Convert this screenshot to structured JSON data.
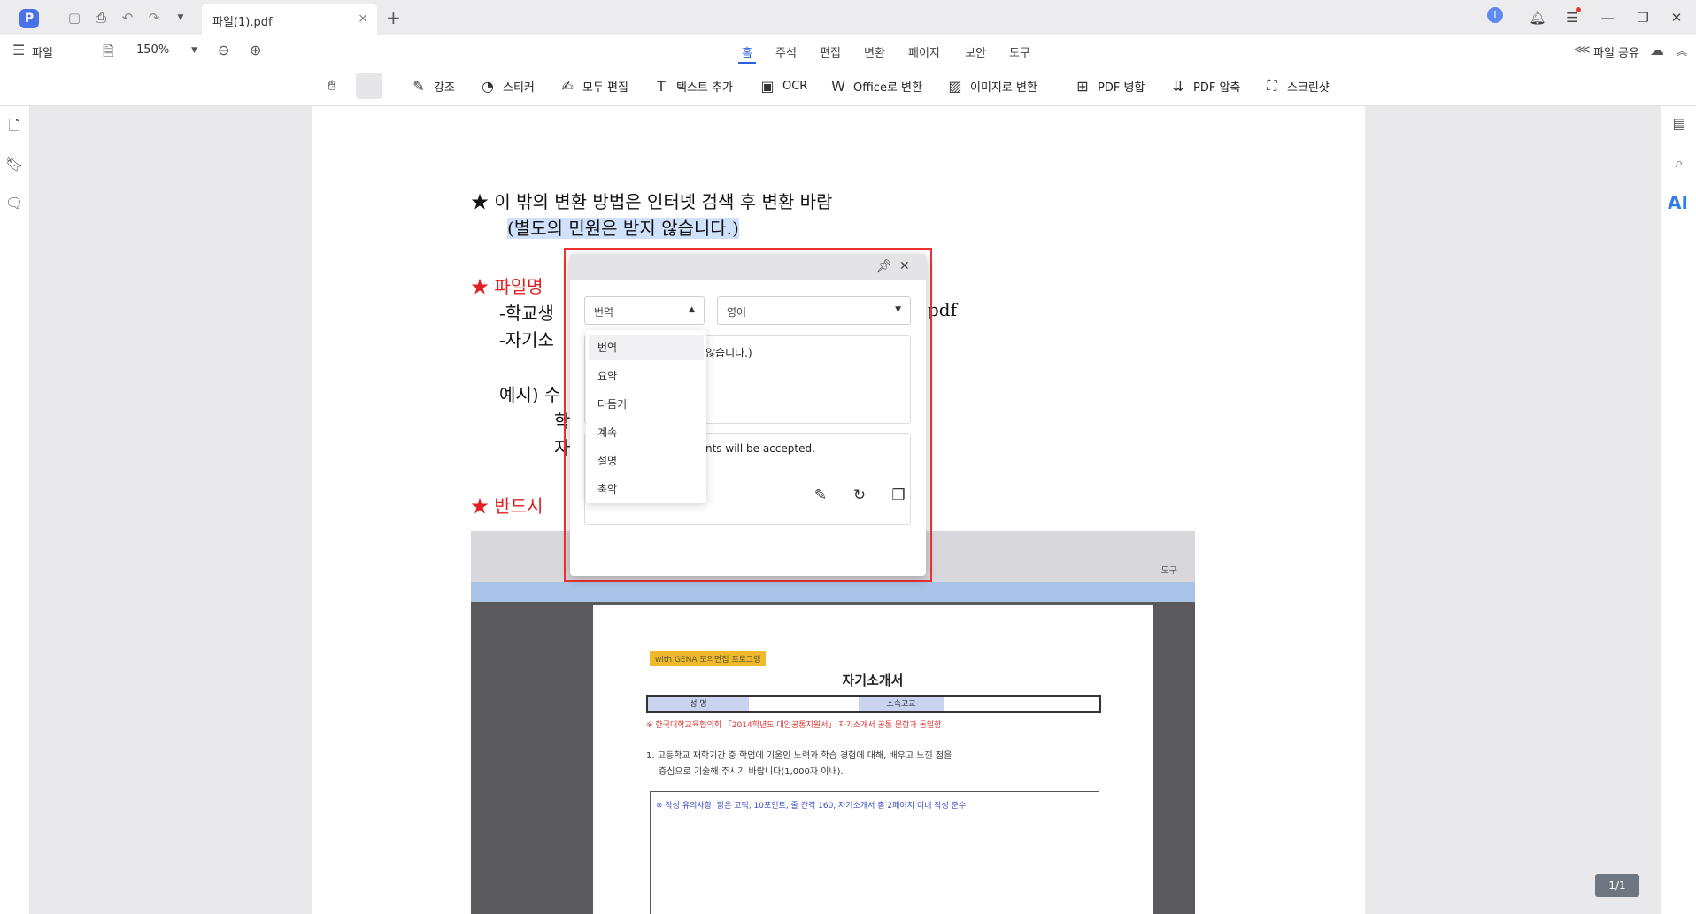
{
  "titlebar": {
    "tab_title": "파일(1).pdf",
    "tab_close": "×",
    "tab_add": "+",
    "user_initial": "I"
  },
  "menubar": {
    "file_label": "파일",
    "zoom_value": "150%",
    "nav_tabs": [
      "홈",
      "주석",
      "편집",
      "변환",
      "페이지",
      "보안",
      "도구"
    ],
    "active_tab": "홈",
    "share_label": "파일 공유"
  },
  "toolbar": {
    "tools": [
      "강조",
      "스티커",
      "모두 편집",
      "텍스트 추가",
      "OCR",
      "Office로 변환",
      "이미지로 변환",
      "PDF 병합",
      "PDF 압축",
      "스크린샷"
    ]
  },
  "right_rail": {
    "ai_label": "AI"
  },
  "document": {
    "line1": "★ 이 밖의 변환 방법은 인터넷 검색 후 변환 바람",
    "line2": "(별도의 민원은 받지 않습니다.)",
    "heading_filename": "★ 파일명",
    "line_student": "-학교생",
    "line_pdf_suffix": "pdf",
    "line_self": "-자기소",
    "example_label": "예시) 수",
    "example_ha": "학",
    "example_ja": "자",
    "heading_must": "★ 반드시"
  },
  "embedded_image": {
    "tag": "with GENA 모의면접 프로그램",
    "title": "자기소개서",
    "table_cells": [
      "성  명",
      "소속고교"
    ],
    "note": "※ 한국대학교육협의회 「2014학년도 대입공통지원서」 자기소개서 공통 문항과 동일함",
    "question": "1. 고등학교 재학기간 중 학업에 기울인 노력과 학습 경험에 대해, 배우고 느낀 점을",
    "question_line2": "중심으로 기술해 주시기 바랍니다(1,000자 이내).",
    "box_text": "※ 작성 유의사항: 맑은 고딕, 10포인트, 줄 간격 160, 자기소개서 총 2페이지 이내 작성 준수",
    "toolbar_text": "도구"
  },
  "popup": {
    "mode_select": "번역",
    "language_select": "영어",
    "source_text": "않습니다.)",
    "result_text": "nts will be accepted.",
    "mode_options": [
      "번역",
      "요약",
      "다듬기",
      "계속",
      "설명",
      "축약"
    ],
    "selected_option": "번역"
  },
  "page_counter": "1/1"
}
